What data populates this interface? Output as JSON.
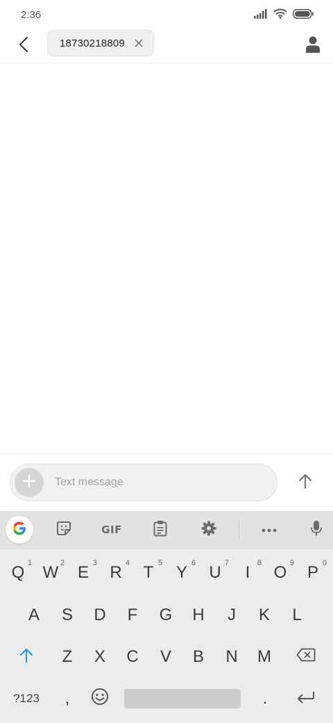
{
  "status_bar": {
    "time": "2:36"
  },
  "header": {
    "recipient_chip": "18730218809"
  },
  "composer": {
    "placeholder": "Text message"
  },
  "keyboard": {
    "toolbar": {
      "gif_label": "GIF"
    },
    "row1": [
      {
        "k": "Q",
        "n": "1"
      },
      {
        "k": "W",
        "n": "2"
      },
      {
        "k": "E",
        "n": "3"
      },
      {
        "k": "R",
        "n": "4"
      },
      {
        "k": "T",
        "n": "5"
      },
      {
        "k": "Y",
        "n": "6"
      },
      {
        "k": "U",
        "n": "7"
      },
      {
        "k": "I",
        "n": "8"
      },
      {
        "k": "O",
        "n": "9"
      },
      {
        "k": "P",
        "n": "0"
      }
    ],
    "row2": [
      "A",
      "S",
      "D",
      "F",
      "G",
      "H",
      "J",
      "K",
      "L"
    ],
    "row3": [
      "Z",
      "X",
      "C",
      "V",
      "B",
      "N",
      "M"
    ],
    "symbols_label": "?123",
    "comma": ",",
    "period": "."
  }
}
